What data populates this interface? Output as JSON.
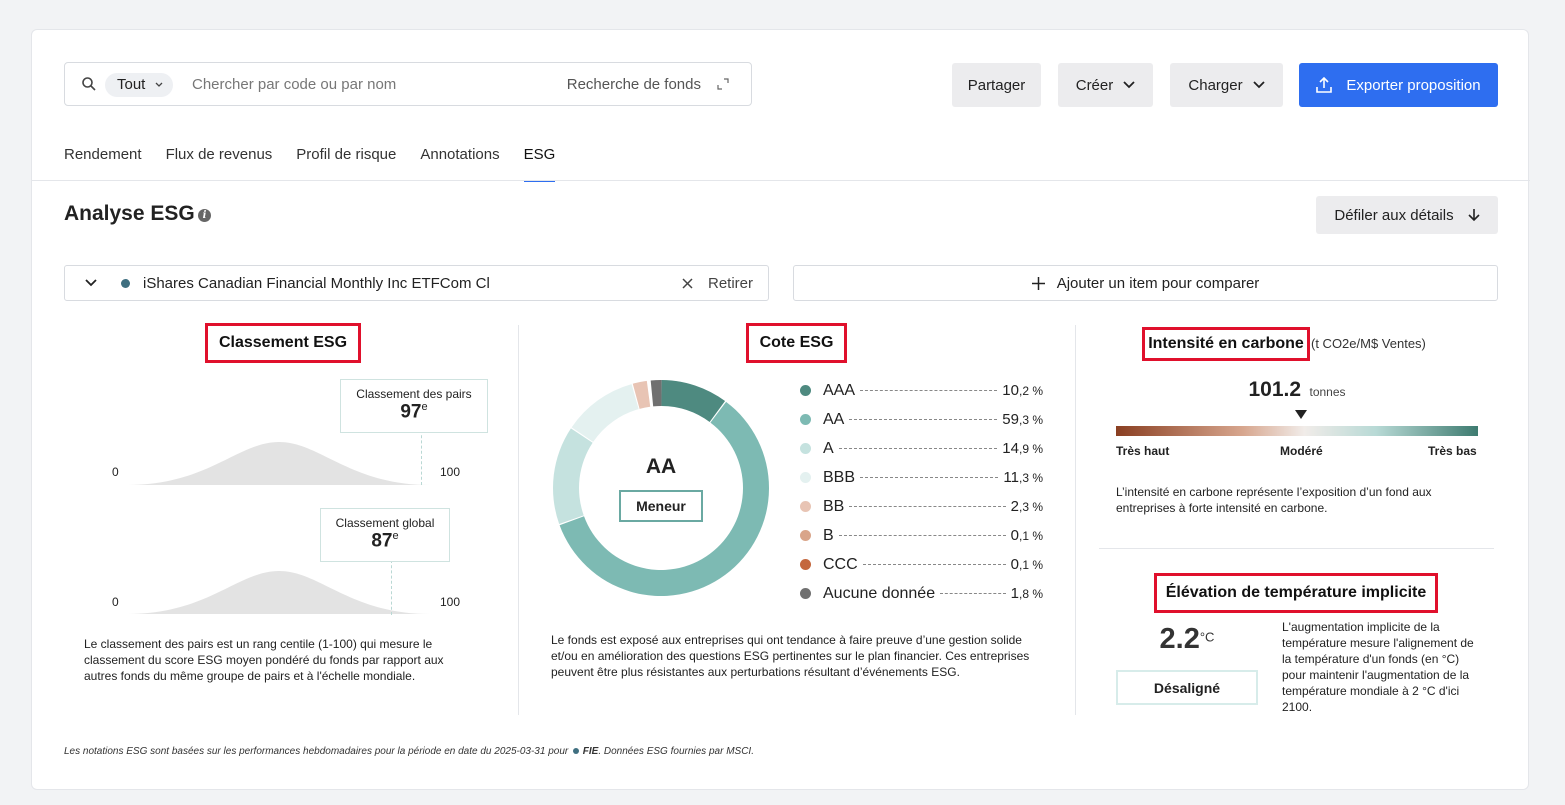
{
  "search": {
    "scope": "Tout",
    "placeholder": "Chercher par code ou par nom",
    "fund_search": "Recherche de fonds"
  },
  "toolbar": {
    "share": "Partager",
    "create": "Créer",
    "load": "Charger",
    "export": "Exporter proposition"
  },
  "tabs": [
    {
      "label": "Rendement"
    },
    {
      "label": "Flux de revenus"
    },
    {
      "label": "Profil de risque"
    },
    {
      "label": "Annotations"
    },
    {
      "label": "ESG",
      "active": true
    }
  ],
  "page": {
    "title": "Analyse ESG",
    "scroll_label": "Défiler aux détails"
  },
  "fund": {
    "name": "iShares Canadian Financial Monthly Inc ETFCom Cl",
    "remove": "Retirer",
    "dot_color": "#3f6f80"
  },
  "compare": {
    "label": "Ajouter un item pour comparer"
  },
  "ranking": {
    "title": "Classement ESG",
    "peer": {
      "label": "Classement des pairs",
      "value": "97",
      "suffix": "e",
      "fraction": 0.97
    },
    "global": {
      "label": "Classement global",
      "value": "87",
      "suffix": "e",
      "fraction": 0.87
    },
    "axis_min": "0",
    "axis_max": "100",
    "note": "Le classement des pairs est un rang centile (1-100) qui mesure le classement du score ESG moyen pondéré du fonds par rapport aux autres fonds du même groupe de pairs et à l'échelle mondiale."
  },
  "rating": {
    "title": "Cote ESG",
    "grade": "AA",
    "badge": "Meneur",
    "note": "Le fonds est exposé aux entreprises qui ont tendance à faire preuve d’une gestion solide et/ou en amélioration des questions ESG pertinentes sur le plan financier. Ces entreprises peuvent être plus résistantes aux perturbations résultant d’événements ESG."
  },
  "chart_data": {
    "type": "pie",
    "categories": [
      "AAA",
      "AA",
      "A",
      "BBB",
      "BB",
      "B",
      "CCC",
      "Aucune donnée"
    ],
    "values": [
      10.2,
      59.3,
      14.9,
      11.3,
      2.3,
      0.1,
      0.1,
      1.8
    ],
    "value_labels": [
      {
        "int": "10",
        "dec": ",2 %"
      },
      {
        "int": "59",
        "dec": ",3 %"
      },
      {
        "int": "14",
        "dec": ",9 %"
      },
      {
        "int": "11",
        "dec": ",3 %"
      },
      {
        "int": "2",
        "dec": ",3 %"
      },
      {
        "int": "0",
        "dec": ",1 %"
      },
      {
        "int": "0",
        "dec": ",1 %"
      },
      {
        "int": "1",
        "dec": ",8 %"
      }
    ],
    "colors": [
      "#4e8a80",
      "#7dbab3",
      "#c5e2df",
      "#e4f1f0",
      "#e8c4b4",
      "#d9a58a",
      "#c4673e",
      "#707070"
    ],
    "legend": "right"
  },
  "carbon": {
    "title": "Intensité en carbone",
    "unit": "(t CO2e/M$ Ventes)",
    "value": "101.2",
    "value_unit": "tonnes",
    "marker_fraction": 0.51,
    "scale_left": "Très haut",
    "scale_mid": "Modéré",
    "scale_right": "Très bas",
    "note": "L’intensité en carbone représente l’exposition d’un fond aux entreprises à forte intensité en carbone."
  },
  "temperature": {
    "title": "Élévation de température implicite",
    "value": "2.2",
    "unit": "°C",
    "badge": "Désaligné",
    "note": "L'augmentation implicite de la température mesure l'alignement de la température d'un fonds (en °C) pour maintenir l'augmentation de la température mondiale à 2 °C d'ici 2100."
  },
  "footer": {
    "pre": "Les notations ESG sont basées sur les performances hebdomadaires pour la période en date du 2025-03-31 pour",
    "fund_code": "FIE",
    "post": ". Données ESG fournies par MSCI."
  }
}
